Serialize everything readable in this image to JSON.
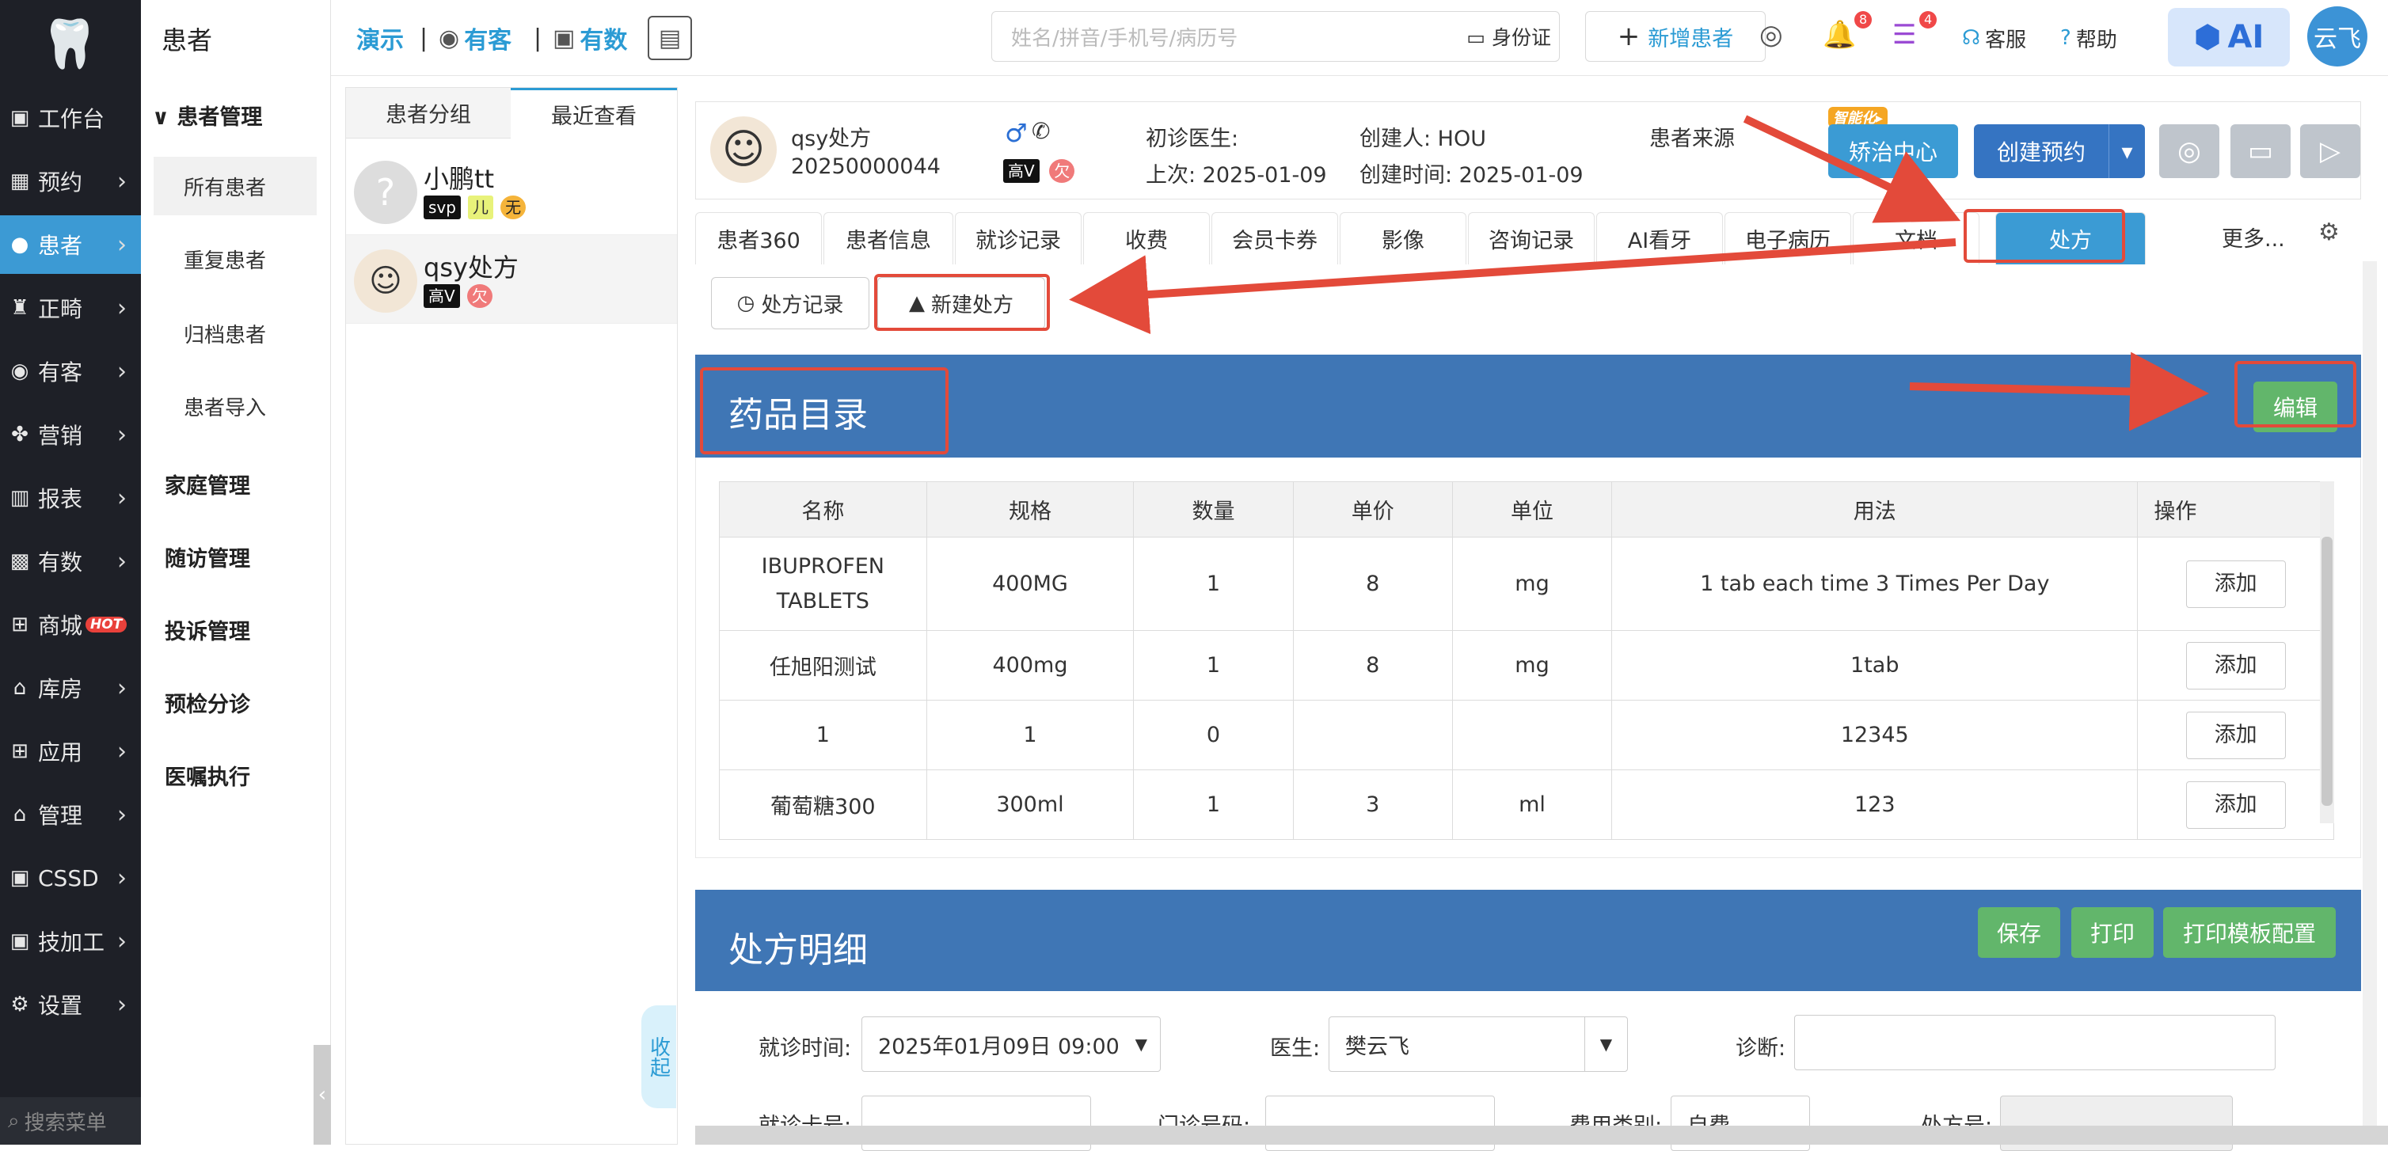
{
  "sidebar": {
    "items": [
      {
        "label": "工作台",
        "icon": "dashboard-icon",
        "chev": ""
      },
      {
        "label": "预约",
        "icon": "calendar-icon",
        "chev": "›"
      },
      {
        "label": "患者",
        "icon": "user-icon",
        "chev": "›"
      },
      {
        "label": "正畸",
        "icon": "tooth-icon",
        "chev": "›"
      },
      {
        "label": "有客",
        "icon": "customer-icon",
        "chev": "›"
      },
      {
        "label": "营销",
        "icon": "marketing-icon",
        "chev": "›"
      },
      {
        "label": "报表",
        "icon": "report-icon",
        "chev": "›"
      },
      {
        "label": "有数",
        "icon": "chart-icon",
        "chev": "›"
      },
      {
        "label": "商城",
        "icon": "cart-icon",
        "chev": "",
        "hot": "HOT"
      },
      {
        "label": "库房",
        "icon": "warehouse-icon",
        "chev": "›"
      },
      {
        "label": "应用",
        "icon": "apps-icon",
        "chev": "›"
      },
      {
        "label": "管理",
        "icon": "manage-icon",
        "chev": "›"
      },
      {
        "label": "CSSD",
        "icon": "cssd-icon",
        "chev": "›"
      },
      {
        "label": "技加工",
        "icon": "tech-icon",
        "chev": "›"
      },
      {
        "label": "设置",
        "icon": "gear-icon",
        "chev": "›"
      }
    ],
    "search_placeholder": "搜索菜单"
  },
  "subnav": {
    "title": "患者",
    "group": "患者管理",
    "items": [
      "所有患者",
      "重复患者",
      "归档患者",
      "患者导入"
    ],
    "sections": [
      "家庭管理",
      "随访管理",
      "投诉管理",
      "预检分诊",
      "医嘱执行"
    ]
  },
  "topbar": {
    "demo": "演示",
    "youke": "有客",
    "youshu": "有数",
    "search_placeholder": "姓名/拼音/手机号/病历号",
    "idcard": "身份证",
    "new_patient": "新增患者",
    "bell_count": "8",
    "task_count": "4",
    "service": "客服",
    "help": "帮助",
    "ai": "AI",
    "user": "云飞"
  },
  "patient_list": {
    "tabs": [
      "患者分组",
      "最近查看"
    ],
    "rows": [
      {
        "name": "小鹏tt",
        "tags": [
          "svp",
          "儿",
          "无"
        ]
      },
      {
        "name": "qsy处方",
        "tags": [
          "高V",
          "欠"
        ]
      }
    ],
    "collapse": "收起"
  },
  "patient_header": {
    "name": "qsy处方",
    "id": "20250000044",
    "tag": "高V",
    "owe": "欠",
    "first_doctor_label": "初诊医生:",
    "last_visit": "上次: 2025-01-09",
    "creator": "创建人: HOU",
    "created_time": "创建时间: 2025-01-09",
    "source_label": "患者来源",
    "smart_badge": "智能化▸",
    "ortho_center": "矫治中心",
    "create_appt": "创建预约"
  },
  "tabs": [
    "患者360",
    "患者信息",
    "就诊记录",
    "收费",
    "会员卡券",
    "影像",
    "咨询记录",
    "AI看牙",
    "电子病历",
    "文档",
    "处方"
  ],
  "tabs_more": "更多...",
  "rx_buttons": {
    "records": "处方记录",
    "new": "新建处方"
  },
  "drug_catalog": {
    "title": "药品目录",
    "edit": "编辑",
    "columns": [
      "名称",
      "规格",
      "数量",
      "单价",
      "单位",
      "用法",
      "操作"
    ],
    "rows": [
      [
        "IBUPROFEN TABLETS",
        "400MG",
        "1",
        "8",
        "mg",
        "1 tab each time 3 Times Per Day",
        "添加"
      ],
      [
        "任旭阳测试",
        "400mg",
        "1",
        "8",
        "mg",
        "1tab",
        "添加"
      ],
      [
        "1",
        "1",
        "0",
        "",
        "",
        "12345",
        "添加"
      ],
      [
        "葡萄糖300",
        "300ml",
        "1",
        "3",
        "ml",
        "123",
        "添加"
      ]
    ]
  },
  "rx_detail": {
    "title": "处方明细",
    "save": "保存",
    "print": "打印",
    "print_tpl": "打印模板配置",
    "visit_time_label": "就诊时间:",
    "visit_time": "2025年01月09日 09:00",
    "doctor_label": "医生:",
    "doctor": "樊云飞",
    "diagnosis_label": "诊断:",
    "card_label": "就诊卡号:",
    "outpatient_label": "门诊号码:",
    "fee_label": "费用类别:",
    "fee_value": "自费",
    "rx_no_label": "处方号:"
  },
  "colors": {
    "accent": "#3b9bd4",
    "header_blue": "#3f76b5",
    "green": "#62b66b",
    "annotation_red": "#e34a3a",
    "sidebar": "#1e2027"
  }
}
